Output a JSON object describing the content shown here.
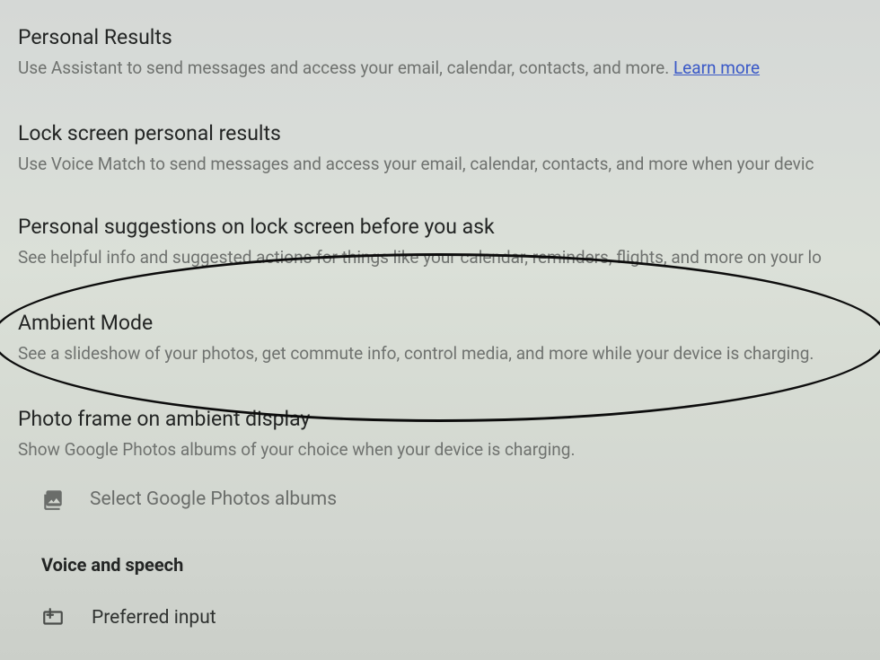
{
  "settings": {
    "personal_results": {
      "title": "Personal Results",
      "desc_head": "Use Assistant to send messages and access your email, calendar, contacts, and more. ",
      "learn_more": "Learn more"
    },
    "lock_screen_personal": {
      "title": "Lock screen personal results",
      "desc": "Use Voice Match to send messages and access your email, calendar, contacts, and more when your devic"
    },
    "personal_suggestions": {
      "title": "Personal suggestions on lock screen before you ask",
      "desc": "See helpful info and suggested actions for things like your calendar, reminders, flights, and more on your lo"
    },
    "ambient_mode": {
      "title": "Ambient Mode",
      "desc": "See a slideshow of your photos, get commute info, control media, and more while your device is charging."
    },
    "photo_frame": {
      "title": "Photo frame on ambient display",
      "desc": "Show Google Photos albums of your choice when your device is charging."
    },
    "select_photos": {
      "label": "Select Google Photos albums"
    }
  },
  "section": {
    "voice_speech": "Voice and speech"
  },
  "preferred_input": {
    "label": "Preferred input"
  }
}
